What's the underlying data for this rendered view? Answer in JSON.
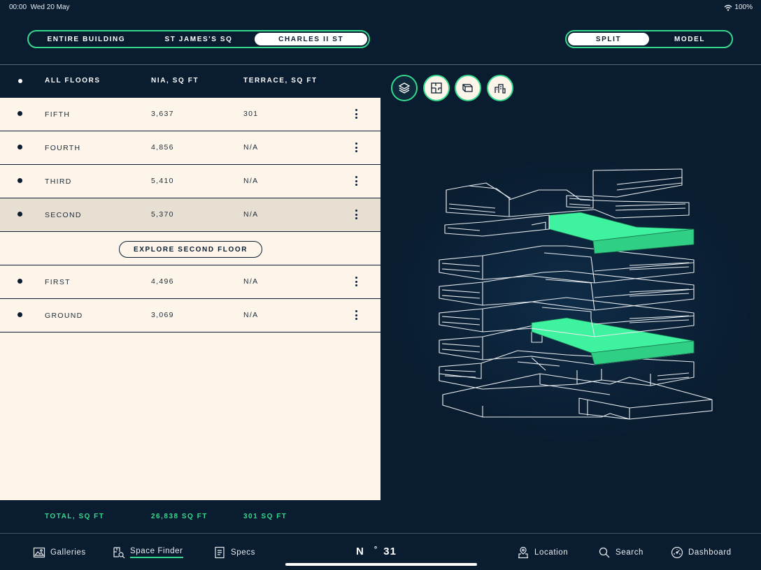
{
  "status": {
    "time": "00:00",
    "date": "Wed 20 May",
    "battery": "100%"
  },
  "building_tabs": [
    "ENTIRE BUILDING",
    "ST JAMES'S SQ",
    "CHARLES II ST"
  ],
  "view_tabs": [
    "SPLIT",
    "MODEL"
  ],
  "table": {
    "headers": [
      "ALL FLOORS",
      "NIA, SQ FT",
      "TERRACE, SQ FT"
    ],
    "rows": [
      {
        "floor": "FIFTH",
        "nia": "3,637",
        "terrace": "301"
      },
      {
        "floor": "FOURTH",
        "nia": "4,856",
        "terrace": "N/A"
      },
      {
        "floor": "THIRD",
        "nia": "5,410",
        "terrace": "N/A"
      },
      {
        "floor": "SECOND",
        "nia": "5,370",
        "terrace": "N/A"
      },
      {
        "floor": "FIRST",
        "nia": "4,496",
        "terrace": "N/A"
      },
      {
        "floor": "GROUND",
        "nia": "3,069",
        "terrace": "N/A"
      }
    ],
    "explore_label": "EXPLORE SECOND FLOOR",
    "totals": {
      "label": "TOTAL, SQ FT",
      "nia": "26,838 SQ FT",
      "terrace": "301 SQ FT"
    }
  },
  "tools": [
    "layers-icon",
    "floorplan-icon",
    "stack-icon",
    "building-icon"
  ],
  "nav": {
    "galleries": "Galleries",
    "space_finder": "Space Finder",
    "specs": "Specs",
    "location": "Location",
    "search": "Search",
    "dashboard": "Dashboard"
  },
  "compass": {
    "dir": "N",
    "deg": "°",
    "value": "31"
  },
  "colors": {
    "bg": "#0a1c30",
    "accent": "#35d98e",
    "panel": "#fdf5ea",
    "selected": "#e8dfd3"
  }
}
